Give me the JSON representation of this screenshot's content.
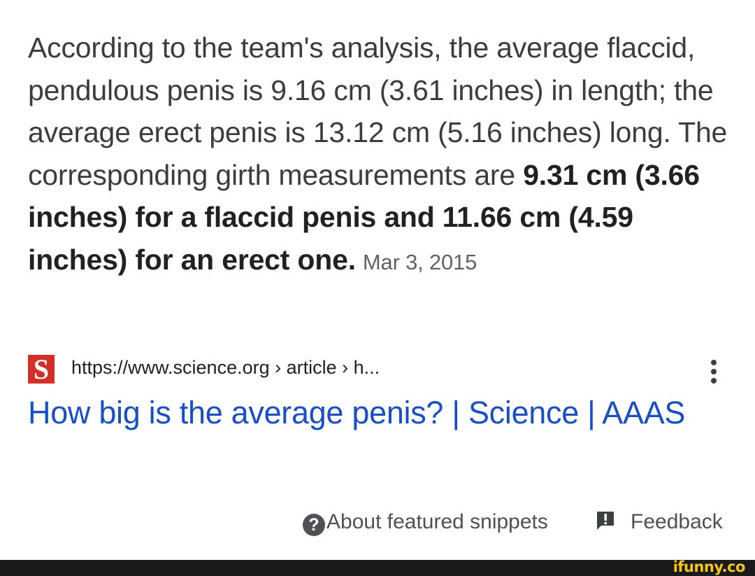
{
  "snippet": {
    "text_plain": "According to the team's analysis, the average flaccid, pendulous penis is 9.16 cm (3.61 inches) in length; the average erect penis is 13.12 cm (5.16 inches) long. The corresponding girth measurements are ",
    "text_bold": "9.31 cm (3.66 inches) for a flaccid penis and 11.66 cm (4.59 inches) for an erect one.",
    "date": "Mar 3, 2015"
  },
  "source": {
    "favicon_letter": "S",
    "url": "https://www.science.org › article › h..."
  },
  "result": {
    "title": "How big is the average penis? | Science | AAAS"
  },
  "footer": {
    "about_icon_glyph": "?",
    "about_label": "About featured snippets",
    "feedback_label": "Feedback"
  },
  "watermark": {
    "text": "ifunny.co"
  },
  "colors": {
    "link_blue": "#1a4fc4",
    "favicon_red": "#d4302a",
    "watermark_yellow": "#f3c61f"
  }
}
